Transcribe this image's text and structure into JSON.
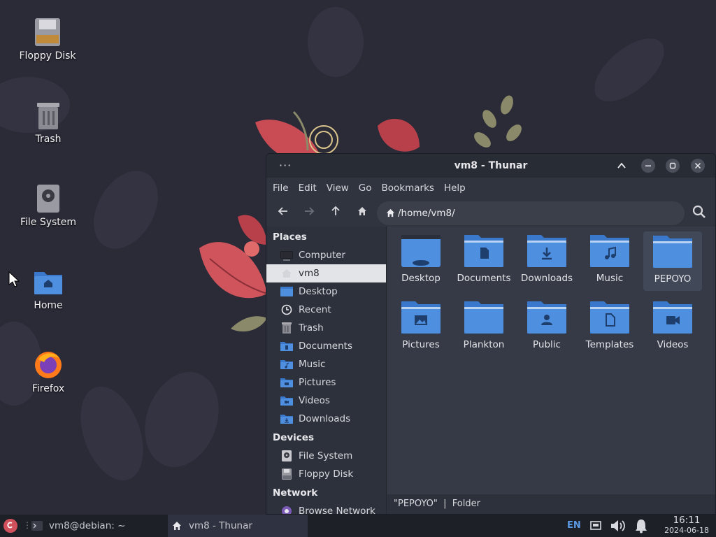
{
  "desktop": {
    "icons": [
      {
        "label": "Floppy Disk",
        "icon": "floppy-disk-icon"
      },
      {
        "label": "Trash",
        "icon": "trash-icon"
      },
      {
        "label": "File System",
        "icon": "hard-drive-icon"
      },
      {
        "label": "Home",
        "icon": "home-folder-icon"
      },
      {
        "label": "Firefox",
        "icon": "firefox-icon"
      }
    ]
  },
  "window": {
    "menu_glyph": "···",
    "title": "vm8 - Thunar",
    "menubar": [
      "File",
      "Edit",
      "View",
      "Go",
      "Bookmarks",
      "Help"
    ],
    "path": "/home/vm8/",
    "sidebar": {
      "places_header": "Places",
      "places": [
        {
          "label": "Computer",
          "icon": "computer-icon"
        },
        {
          "label": "vm8",
          "icon": "home-icon",
          "active": true
        },
        {
          "label": "Desktop",
          "icon": "desktop-icon"
        },
        {
          "label": "Recent",
          "icon": "clock-icon"
        },
        {
          "label": "Trash",
          "icon": "trash-icon"
        },
        {
          "label": "Documents",
          "icon": "documents-folder-icon"
        },
        {
          "label": "Music",
          "icon": "music-folder-icon"
        },
        {
          "label": "Pictures",
          "icon": "pictures-folder-icon"
        },
        {
          "label": "Videos",
          "icon": "videos-folder-icon"
        },
        {
          "label": "Downloads",
          "icon": "downloads-folder-icon"
        }
      ],
      "devices_header": "Devices",
      "devices": [
        {
          "label": "File System",
          "icon": "hard-drive-icon"
        },
        {
          "label": "Floppy Disk",
          "icon": "floppy-disk-icon"
        }
      ],
      "network_header": "Network",
      "network": [
        {
          "label": "Browse Network",
          "icon": "network-icon"
        }
      ]
    },
    "files": [
      {
        "label": "Desktop",
        "emblem": "desktop"
      },
      {
        "label": "Documents",
        "emblem": "document"
      },
      {
        "label": "Downloads",
        "emblem": "download"
      },
      {
        "label": "Music",
        "emblem": "music"
      },
      {
        "label": "PEPOYO",
        "emblem": "none",
        "selected": true
      },
      {
        "label": "Pictures",
        "emblem": "picture"
      },
      {
        "label": "Plankton",
        "emblem": "none"
      },
      {
        "label": "Public",
        "emblem": "person"
      },
      {
        "label": "Templates",
        "emblem": "template"
      },
      {
        "label": "Videos",
        "emblem": "video"
      }
    ],
    "status": "\"PEPOYO\"  |  Folder"
  },
  "taskbar": {
    "terminal_label": "vm8@debian: ~",
    "thunar_label": "vm8 - Thunar",
    "keyboard_layout": "EN",
    "time": "16:11",
    "date": "2024-06-18"
  },
  "colors": {
    "folder_blue": "#4f8fe0",
    "folder_tab": "#3a78cc",
    "accent_red": "#d0505c"
  }
}
